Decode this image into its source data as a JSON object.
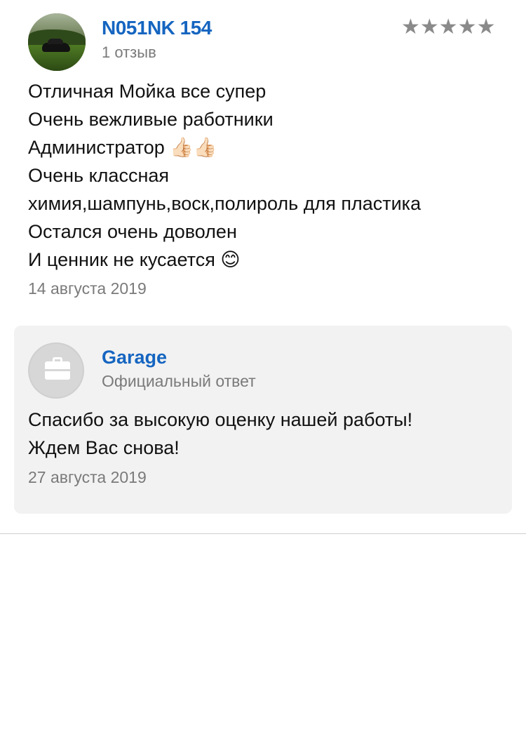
{
  "review": {
    "author": {
      "name": "N051NK 154",
      "reviews_count": "1 отзыв",
      "avatar": "car-photo-avatar"
    },
    "rating": {
      "stars_text": "★★★★★",
      "value": 5,
      "max": 5,
      "color": "#8a8a8a"
    },
    "text_lines": [
      "Отличная Мойка все супер",
      "Очень вежливые работники",
      "Администратор 👍🏻👍🏻",
      "Очень классная",
      "химия,шампунь,воск,полироль для пластика",
      "Остался очень доволен",
      "И ценник не кусается 😊"
    ],
    "date": "14 августа 2019"
  },
  "reply": {
    "author": "Garage",
    "label": "Официальный ответ",
    "avatar_icon": "briefcase-icon",
    "text_lines": [
      "Спасибо за высокую оценку нашей работы!",
      "Ждем Вас снова!"
    ],
    "date": "27 августа 2019"
  },
  "colors": {
    "link": "#1565c0",
    "muted": "#7a7a7a",
    "reply_bg": "#f2f2f2"
  }
}
